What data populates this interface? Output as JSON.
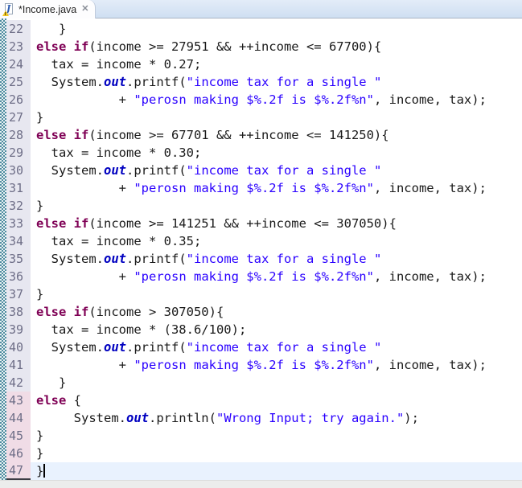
{
  "tab": {
    "title": "*Income.java",
    "file_icon": "java-file-warning-icon",
    "close_glyph": "✕"
  },
  "editor": {
    "colors": {
      "keyword": "#7f0055",
      "string": "#2a00ff",
      "static_field": "#0000c0",
      "plain": "#1a1a1a",
      "line_number": "#6e6e87",
      "gutter_bg": "#e7e7f0",
      "gutter_changed_bg": "#f0dce6",
      "current_line_bg": "#e9f2fe",
      "tabbar_bg": "#d5e2f2",
      "annotation_checker": "#4e8ca0"
    },
    "lines": [
      {
        "n": 22,
        "changed": false,
        "current": false,
        "seg": [
          [
            "p",
            "   }"
          ]
        ]
      },
      {
        "n": 23,
        "changed": false,
        "current": false,
        "seg": [
          [
            "k",
            "else if"
          ],
          [
            "p",
            "(income >= 27951 && ++income <= 67700){"
          ]
        ]
      },
      {
        "n": 24,
        "changed": false,
        "current": false,
        "seg": [
          [
            "p",
            "  tax = income * 0.27;"
          ]
        ]
      },
      {
        "n": 25,
        "changed": false,
        "current": false,
        "seg": [
          [
            "p",
            "  System."
          ],
          [
            "f",
            "out"
          ],
          [
            "p",
            ".printf("
          ],
          [
            "s",
            "\"income tax for a single \""
          ]
        ]
      },
      {
        "n": 26,
        "changed": false,
        "current": false,
        "seg": [
          [
            "p",
            "           + "
          ],
          [
            "s",
            "\"perosn making $%.2f is $%.2f%n\""
          ],
          [
            "p",
            ", income, tax);"
          ]
        ]
      },
      {
        "n": 27,
        "changed": false,
        "current": false,
        "seg": [
          [
            "p",
            "}"
          ]
        ]
      },
      {
        "n": 28,
        "changed": false,
        "current": false,
        "seg": [
          [
            "k",
            "else if"
          ],
          [
            "p",
            "(income >= 67701 && ++income <= 141250){"
          ]
        ]
      },
      {
        "n": 29,
        "changed": false,
        "current": false,
        "seg": [
          [
            "p",
            "  tax = income * 0.30;"
          ]
        ]
      },
      {
        "n": 30,
        "changed": false,
        "current": false,
        "seg": [
          [
            "p",
            "  System."
          ],
          [
            "f",
            "out"
          ],
          [
            "p",
            ".printf("
          ],
          [
            "s",
            "\"income tax for a single \""
          ]
        ]
      },
      {
        "n": 31,
        "changed": false,
        "current": false,
        "seg": [
          [
            "p",
            "           + "
          ],
          [
            "s",
            "\"perosn making $%.2f is $%.2f%n\""
          ],
          [
            "p",
            ", income, tax);"
          ]
        ]
      },
      {
        "n": 32,
        "changed": false,
        "current": false,
        "seg": [
          [
            "p",
            "}"
          ]
        ]
      },
      {
        "n": 33,
        "changed": false,
        "current": false,
        "seg": [
          [
            "k",
            "else if"
          ],
          [
            "p",
            "(income >= 141251 && ++income <= 307050){"
          ]
        ]
      },
      {
        "n": 34,
        "changed": false,
        "current": false,
        "seg": [
          [
            "p",
            "  tax = income * 0.35;"
          ]
        ]
      },
      {
        "n": 35,
        "changed": false,
        "current": false,
        "seg": [
          [
            "p",
            "  System."
          ],
          [
            "f",
            "out"
          ],
          [
            "p",
            ".printf("
          ],
          [
            "s",
            "\"income tax for a single \""
          ]
        ]
      },
      {
        "n": 36,
        "changed": false,
        "current": false,
        "seg": [
          [
            "p",
            "           + "
          ],
          [
            "s",
            "\"perosn making $%.2f is $%.2f%n\""
          ],
          [
            "p",
            ", income, tax);"
          ]
        ]
      },
      {
        "n": 37,
        "changed": false,
        "current": false,
        "seg": [
          [
            "p",
            "}"
          ]
        ]
      },
      {
        "n": 38,
        "changed": false,
        "current": false,
        "seg": [
          [
            "k",
            "else if"
          ],
          [
            "p",
            "(income > 307050){"
          ]
        ]
      },
      {
        "n": 39,
        "changed": false,
        "current": false,
        "seg": [
          [
            "p",
            "  tax = income * (38.6/100);"
          ]
        ]
      },
      {
        "n": 40,
        "changed": false,
        "current": false,
        "seg": [
          [
            "p",
            "  System."
          ],
          [
            "f",
            "out"
          ],
          [
            "p",
            ".printf("
          ],
          [
            "s",
            "\"income tax for a single \""
          ]
        ]
      },
      {
        "n": 41,
        "changed": false,
        "current": false,
        "seg": [
          [
            "p",
            "           + "
          ],
          [
            "s",
            "\"perosn making $%.2f is $%.2f%n\""
          ],
          [
            "p",
            ", income, tax);"
          ]
        ]
      },
      {
        "n": 42,
        "changed": false,
        "current": false,
        "seg": [
          [
            "p",
            "   }"
          ]
        ]
      },
      {
        "n": 43,
        "changed": true,
        "current": false,
        "seg": [
          [
            "k",
            "else"
          ],
          [
            "p",
            " {"
          ]
        ]
      },
      {
        "n": 44,
        "changed": true,
        "current": false,
        "seg": [
          [
            "p",
            "     System."
          ],
          [
            "f",
            "out"
          ],
          [
            "p",
            ".println("
          ],
          [
            "s",
            "\"Wrong Input; try again.\""
          ],
          [
            "p",
            ");"
          ]
        ]
      },
      {
        "n": 45,
        "changed": true,
        "current": false,
        "seg": [
          [
            "p",
            "}"
          ]
        ]
      },
      {
        "n": 46,
        "changed": true,
        "current": false,
        "seg": [
          [
            "p",
            "}"
          ]
        ]
      },
      {
        "n": 47,
        "changed": true,
        "current": true,
        "seg": [
          [
            "p",
            "}"
          ]
        ]
      }
    ]
  }
}
